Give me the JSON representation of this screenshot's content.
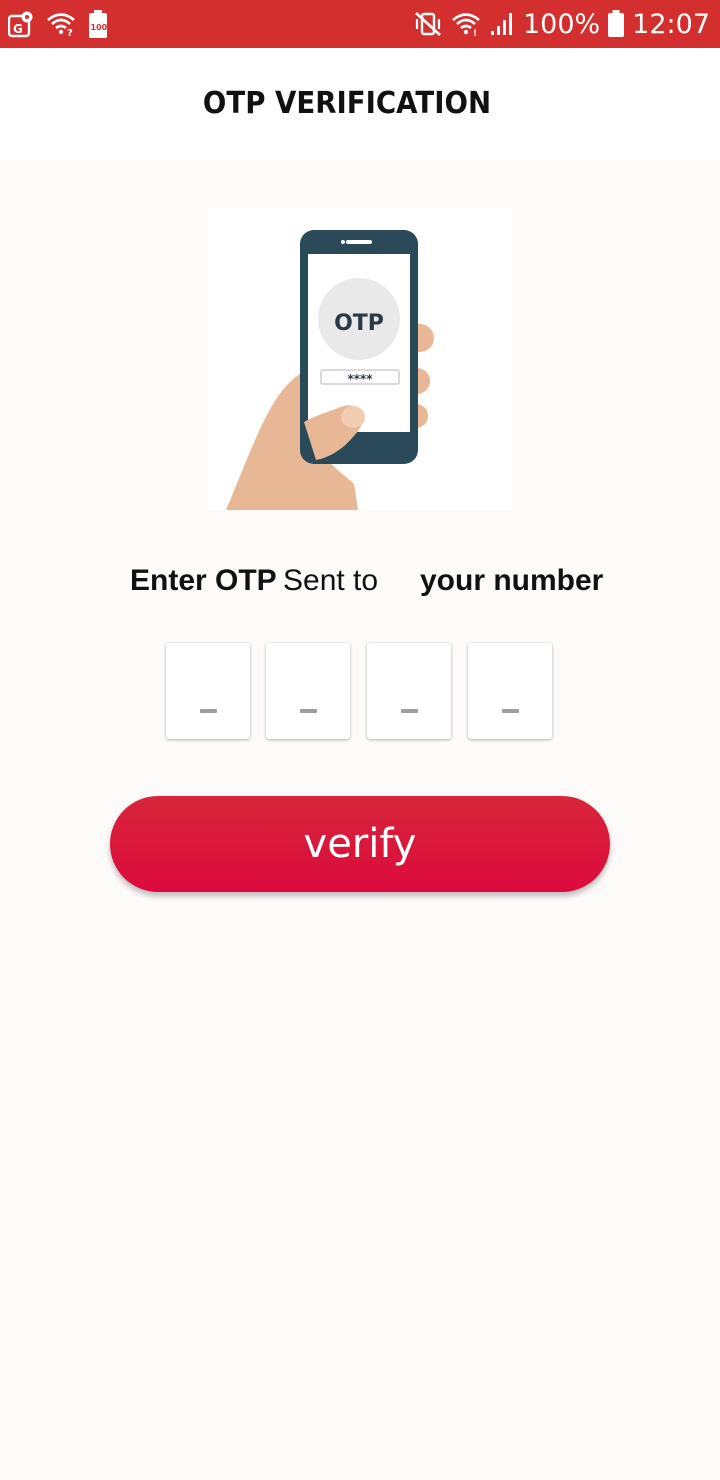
{
  "status_bar": {
    "battery_percent": "100%",
    "time": "12:07",
    "battery_small_label": "100",
    "icons": [
      "gallery-icon",
      "wifi-question-icon",
      "battery-saver-icon",
      "mute-vibrate-icon",
      "wifi-icon",
      "signal-icon",
      "battery-icon"
    ]
  },
  "app_bar": {
    "title": "OTP VERIFICATION"
  },
  "illustration": {
    "screen_label": "OTP",
    "masked_code": "****"
  },
  "prompt": {
    "enter_otp": "Enter OTP",
    "sent_to": "Sent to",
    "number": "your number"
  },
  "otp": {
    "digits": [
      "",
      "",
      "",
      ""
    ],
    "placeholder": "_"
  },
  "verify_button": {
    "label": "verify"
  },
  "colors": {
    "status_bar": "#d32f2f",
    "button": "#dc0a3c",
    "background": "#fdfafa"
  }
}
